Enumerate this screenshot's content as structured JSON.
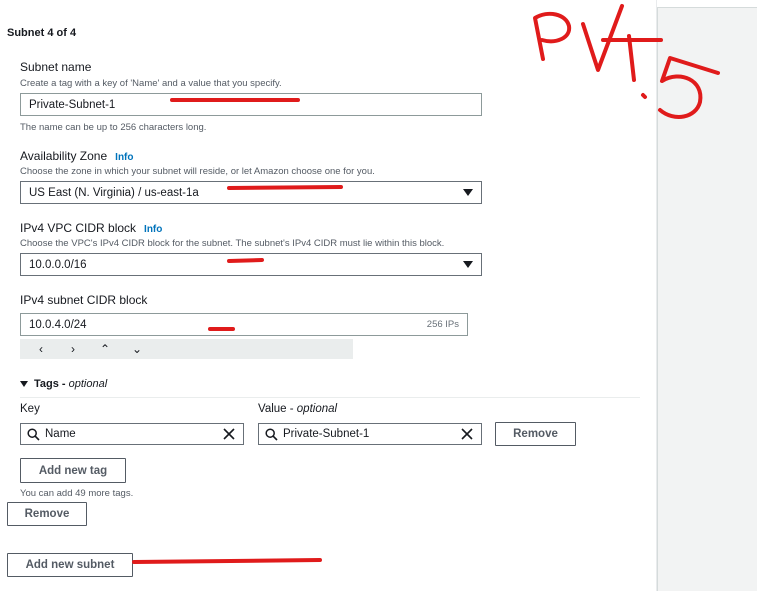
{
  "subnet": {
    "heading": "Subnet 4 of 4",
    "name": {
      "label": "Subnet name",
      "description": "Create a tag with a key of 'Name' and a value that you specify.",
      "value": "Private-Subnet-1",
      "constraint": "The name can be up to 256 characters long."
    },
    "availability_zone": {
      "label": "Availability Zone",
      "info": "Info",
      "description": "Choose the zone in which your subnet will reside, or let Amazon choose one for you.",
      "selected": "US East (N. Virginia) / us-east-1a"
    },
    "vpc_cidr": {
      "label": "IPv4 VPC CIDR block",
      "info": "Info",
      "description": "Choose the VPC's IPv4 CIDR block for the subnet. The subnet's IPv4 CIDR must lie within this block.",
      "selected": "10.0.0.0/16"
    },
    "subnet_cidr": {
      "label": "IPv4 subnet CIDR block",
      "value": "10.0.4.0/24",
      "suffix": "256 IPs",
      "stepper": {
        "left": "‹",
        "right": "›",
        "up": "⌃",
        "down": "⌄"
      }
    },
    "tags": {
      "heading": "Tags - ",
      "heading_optional": "optional",
      "key_label": "Key",
      "value_label": "Value - ",
      "value_optional": "optional",
      "row": {
        "key": "Name",
        "value": "Private-Subnet-1"
      },
      "remove_label": "Remove",
      "add_tag_label": "Add new tag",
      "add_tag_hint": "You can add 49 more tags."
    },
    "remove_subnet_label": "Remove",
    "add_subnet_label": "Add new subnet"
  },
  "annotation": {
    "handwriting": "PVT.5",
    "color": "#e01b1b"
  },
  "icons": {
    "search": "search-icon",
    "clear": "close-icon",
    "caret": "caret-down-icon"
  }
}
